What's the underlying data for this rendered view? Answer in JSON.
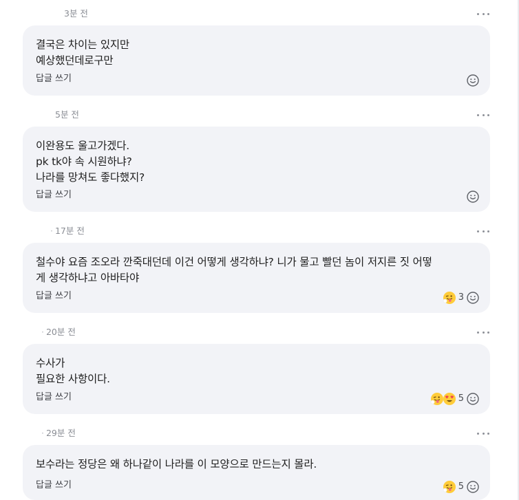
{
  "comments": [
    {
      "time": "3분 전",
      "text": "결국은 차이는 있지만\n예상했던데로구만",
      "reply_label": "답글 쓰기",
      "reaction_count": ""
    },
    {
      "time": "5분 전",
      "text": "이완용도 울고가겠다.\npk tk야 속 시원하냐?\n나라를 망쳐도 좋다했지?",
      "reply_label": "답글 쓰기",
      "reaction_count": ""
    },
    {
      "time": "17분 전",
      "text": "철수야 요즘 조오라 깐죽대던데 이건 어떻게 생각하냐? 니가 물고 빨던 놈이 저지른 짓 어떻게 생각하냐고 아바타야",
      "reply_label": "답글 쓰기",
      "reaction_count": "3",
      "emojis": [
        "tongue-face-emoji"
      ]
    },
    {
      "time": "20분 전",
      "text": "수사가\n필요한 사항이다.",
      "reply_label": "답글 쓰기",
      "reaction_count": "5",
      "emojis": [
        "tongue-face-emoji",
        "heart-eyes-emoji"
      ]
    },
    {
      "time": "29분 전",
      "text": "보수라는 정당은 왜 하나같이 나라를 이 모양으로 만드는지 몰라.",
      "reply_label": "답글 쓰기",
      "reaction_count": "5",
      "emojis": [
        "tongue-face-emoji"
      ]
    }
  ],
  "colors": {
    "bubble_bg": "#f2f3f7",
    "meta_text": "#8a8d94",
    "emoji_yellow": "#ffcc3a",
    "heart_red": "#f0474f"
  }
}
